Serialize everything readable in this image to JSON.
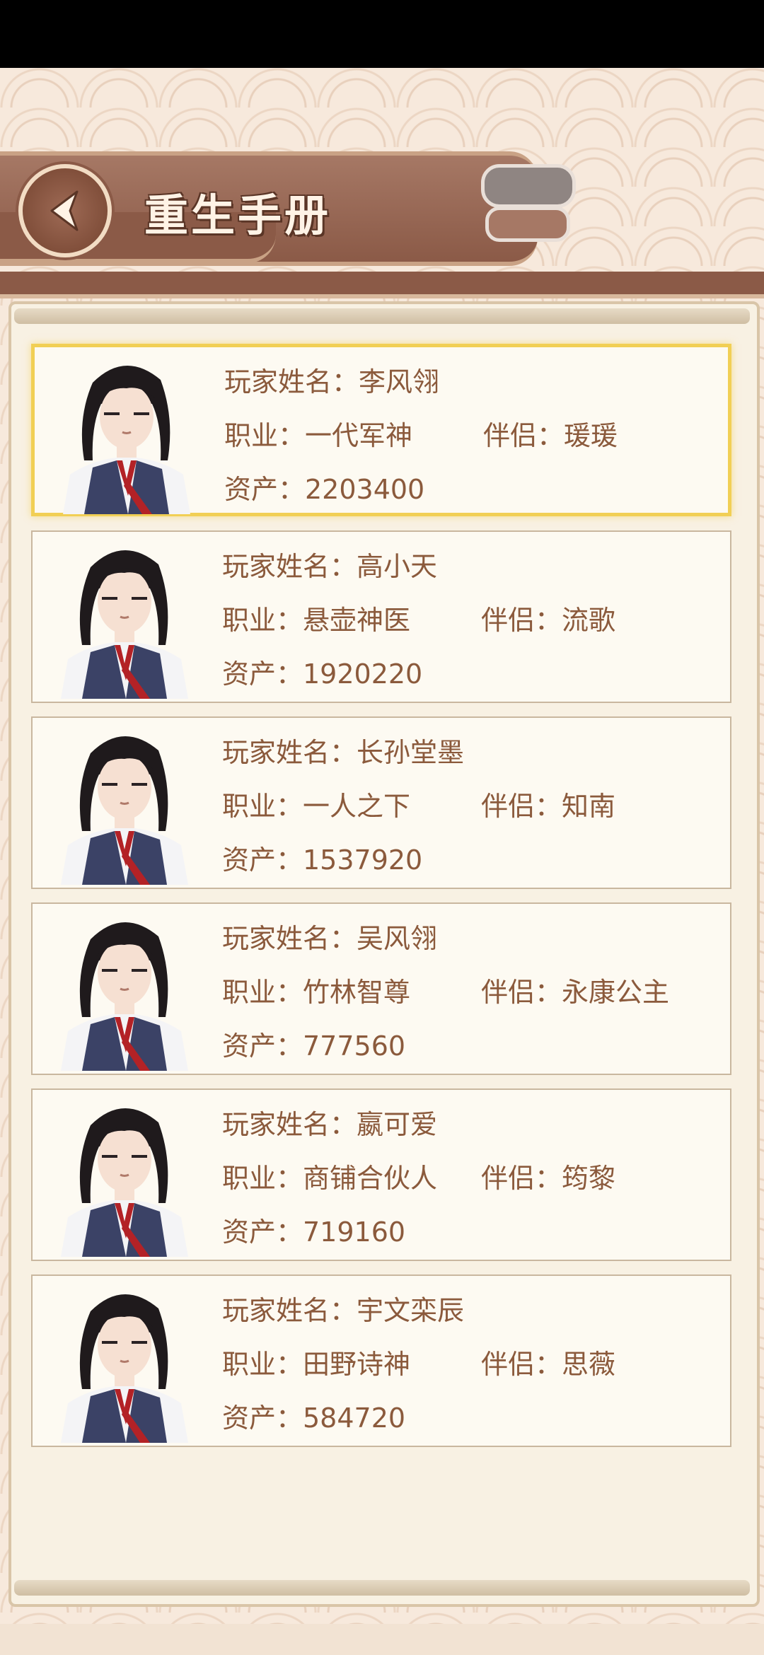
{
  "header": {
    "title": "重生手册"
  },
  "icons": {
    "back": "chevron-left-icon",
    "avatar": "character-portrait-icon"
  },
  "colors": {
    "accent": "#8b5a47",
    "text": "#8b5a3c",
    "selected_border": "#f1cf55"
  },
  "players": [
    {
      "name_label": "玩家姓名：李风翎",
      "job_label": "职业：一代军神",
      "partner_label": "伴侣：瑗瑗",
      "assets_label": "资产：2203400",
      "selected": true
    },
    {
      "name_label": "玩家姓名：高小天",
      "job_label": "职业：悬壶神医",
      "partner_label": "伴侣：流歌",
      "assets_label": "资产：1920220",
      "selected": false
    },
    {
      "name_label": "玩家姓名：长孙堂墨",
      "job_label": "职业：一人之下",
      "partner_label": "伴侣：知南",
      "assets_label": "资产：1537920",
      "selected": false
    },
    {
      "name_label": "玩家姓名：吴风翎",
      "job_label": "职业：竹林智尊",
      "partner_label": "伴侣：永康公主",
      "assets_label": "资产：777560",
      "selected": false
    },
    {
      "name_label": "玩家姓名：嬴可爱",
      "job_label": "职业：商铺合伙人",
      "partner_label": "伴侣：筠黎",
      "assets_label": "资产：719160",
      "selected": false
    },
    {
      "name_label": "玩家姓名：宇文栾辰",
      "job_label": "职业：田野诗神",
      "partner_label": "伴侣：思薇",
      "assets_label": "资产：584720",
      "selected": false
    }
  ]
}
